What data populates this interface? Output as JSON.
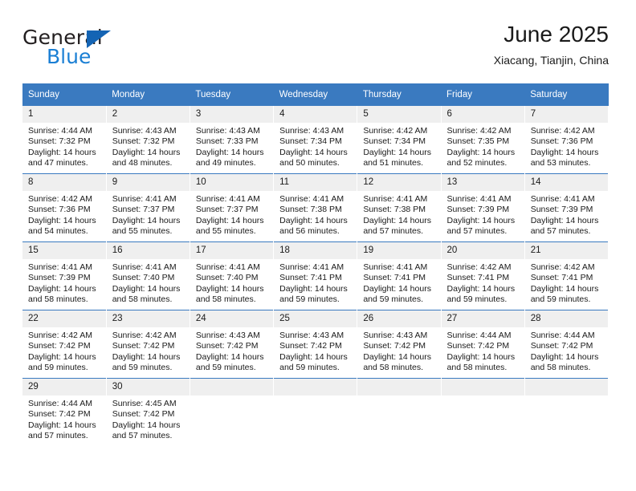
{
  "brand": {
    "name_part1": "General",
    "name_part2": "Blue",
    "logo_icon": "triangle-icon"
  },
  "header": {
    "title": "June 2025",
    "subtitle": "Xiacang, Tianjin, China"
  },
  "calendar": {
    "weekday_headers": [
      "Sunday",
      "Monday",
      "Tuesday",
      "Wednesday",
      "Thursday",
      "Friday",
      "Saturday"
    ],
    "accent_color": "#3a7ac0",
    "daynum_background": "#efefef",
    "weeks": [
      [
        {
          "day": "1",
          "sunrise": "Sunrise: 4:44 AM",
          "sunset": "Sunset: 7:32 PM",
          "daylight_line1": "Daylight: 14 hours",
          "daylight_line2": "and 47 minutes."
        },
        {
          "day": "2",
          "sunrise": "Sunrise: 4:43 AM",
          "sunset": "Sunset: 7:32 PM",
          "daylight_line1": "Daylight: 14 hours",
          "daylight_line2": "and 48 minutes."
        },
        {
          "day": "3",
          "sunrise": "Sunrise: 4:43 AM",
          "sunset": "Sunset: 7:33 PM",
          "daylight_line1": "Daylight: 14 hours",
          "daylight_line2": "and 49 minutes."
        },
        {
          "day": "4",
          "sunrise": "Sunrise: 4:43 AM",
          "sunset": "Sunset: 7:34 PM",
          "daylight_line1": "Daylight: 14 hours",
          "daylight_line2": "and 50 minutes."
        },
        {
          "day": "5",
          "sunrise": "Sunrise: 4:42 AM",
          "sunset": "Sunset: 7:34 PM",
          "daylight_line1": "Daylight: 14 hours",
          "daylight_line2": "and 51 minutes."
        },
        {
          "day": "6",
          "sunrise": "Sunrise: 4:42 AM",
          "sunset": "Sunset: 7:35 PM",
          "daylight_line1": "Daylight: 14 hours",
          "daylight_line2": "and 52 minutes."
        },
        {
          "day": "7",
          "sunrise": "Sunrise: 4:42 AM",
          "sunset": "Sunset: 7:36 PM",
          "daylight_line1": "Daylight: 14 hours",
          "daylight_line2": "and 53 minutes."
        }
      ],
      [
        {
          "day": "8",
          "sunrise": "Sunrise: 4:42 AM",
          "sunset": "Sunset: 7:36 PM",
          "daylight_line1": "Daylight: 14 hours",
          "daylight_line2": "and 54 minutes."
        },
        {
          "day": "9",
          "sunrise": "Sunrise: 4:41 AM",
          "sunset": "Sunset: 7:37 PM",
          "daylight_line1": "Daylight: 14 hours",
          "daylight_line2": "and 55 minutes."
        },
        {
          "day": "10",
          "sunrise": "Sunrise: 4:41 AM",
          "sunset": "Sunset: 7:37 PM",
          "daylight_line1": "Daylight: 14 hours",
          "daylight_line2": "and 55 minutes."
        },
        {
          "day": "11",
          "sunrise": "Sunrise: 4:41 AM",
          "sunset": "Sunset: 7:38 PM",
          "daylight_line1": "Daylight: 14 hours",
          "daylight_line2": "and 56 minutes."
        },
        {
          "day": "12",
          "sunrise": "Sunrise: 4:41 AM",
          "sunset": "Sunset: 7:38 PM",
          "daylight_line1": "Daylight: 14 hours",
          "daylight_line2": "and 57 minutes."
        },
        {
          "day": "13",
          "sunrise": "Sunrise: 4:41 AM",
          "sunset": "Sunset: 7:39 PM",
          "daylight_line1": "Daylight: 14 hours",
          "daylight_line2": "and 57 minutes."
        },
        {
          "day": "14",
          "sunrise": "Sunrise: 4:41 AM",
          "sunset": "Sunset: 7:39 PM",
          "daylight_line1": "Daylight: 14 hours",
          "daylight_line2": "and 57 minutes."
        }
      ],
      [
        {
          "day": "15",
          "sunrise": "Sunrise: 4:41 AM",
          "sunset": "Sunset: 7:39 PM",
          "daylight_line1": "Daylight: 14 hours",
          "daylight_line2": "and 58 minutes."
        },
        {
          "day": "16",
          "sunrise": "Sunrise: 4:41 AM",
          "sunset": "Sunset: 7:40 PM",
          "daylight_line1": "Daylight: 14 hours",
          "daylight_line2": "and 58 minutes."
        },
        {
          "day": "17",
          "sunrise": "Sunrise: 4:41 AM",
          "sunset": "Sunset: 7:40 PM",
          "daylight_line1": "Daylight: 14 hours",
          "daylight_line2": "and 58 minutes."
        },
        {
          "day": "18",
          "sunrise": "Sunrise: 4:41 AM",
          "sunset": "Sunset: 7:41 PM",
          "daylight_line1": "Daylight: 14 hours",
          "daylight_line2": "and 59 minutes."
        },
        {
          "day": "19",
          "sunrise": "Sunrise: 4:41 AM",
          "sunset": "Sunset: 7:41 PM",
          "daylight_line1": "Daylight: 14 hours",
          "daylight_line2": "and 59 minutes."
        },
        {
          "day": "20",
          "sunrise": "Sunrise: 4:42 AM",
          "sunset": "Sunset: 7:41 PM",
          "daylight_line1": "Daylight: 14 hours",
          "daylight_line2": "and 59 minutes."
        },
        {
          "day": "21",
          "sunrise": "Sunrise: 4:42 AM",
          "sunset": "Sunset: 7:41 PM",
          "daylight_line1": "Daylight: 14 hours",
          "daylight_line2": "and 59 minutes."
        }
      ],
      [
        {
          "day": "22",
          "sunrise": "Sunrise: 4:42 AM",
          "sunset": "Sunset: 7:42 PM",
          "daylight_line1": "Daylight: 14 hours",
          "daylight_line2": "and 59 minutes."
        },
        {
          "day": "23",
          "sunrise": "Sunrise: 4:42 AM",
          "sunset": "Sunset: 7:42 PM",
          "daylight_line1": "Daylight: 14 hours",
          "daylight_line2": "and 59 minutes."
        },
        {
          "day": "24",
          "sunrise": "Sunrise: 4:43 AM",
          "sunset": "Sunset: 7:42 PM",
          "daylight_line1": "Daylight: 14 hours",
          "daylight_line2": "and 59 minutes."
        },
        {
          "day": "25",
          "sunrise": "Sunrise: 4:43 AM",
          "sunset": "Sunset: 7:42 PM",
          "daylight_line1": "Daylight: 14 hours",
          "daylight_line2": "and 59 minutes."
        },
        {
          "day": "26",
          "sunrise": "Sunrise: 4:43 AM",
          "sunset": "Sunset: 7:42 PM",
          "daylight_line1": "Daylight: 14 hours",
          "daylight_line2": "and 58 minutes."
        },
        {
          "day": "27",
          "sunrise": "Sunrise: 4:44 AM",
          "sunset": "Sunset: 7:42 PM",
          "daylight_line1": "Daylight: 14 hours",
          "daylight_line2": "and 58 minutes."
        },
        {
          "day": "28",
          "sunrise": "Sunrise: 4:44 AM",
          "sunset": "Sunset: 7:42 PM",
          "daylight_line1": "Daylight: 14 hours",
          "daylight_line2": "and 58 minutes."
        }
      ],
      [
        {
          "day": "29",
          "sunrise": "Sunrise: 4:44 AM",
          "sunset": "Sunset: 7:42 PM",
          "daylight_line1": "Daylight: 14 hours",
          "daylight_line2": "and 57 minutes."
        },
        {
          "day": "30",
          "sunrise": "Sunrise: 4:45 AM",
          "sunset": "Sunset: 7:42 PM",
          "daylight_line1": "Daylight: 14 hours",
          "daylight_line2": "and 57 minutes."
        },
        {
          "day": "",
          "sunrise": "",
          "sunset": "",
          "daylight_line1": "",
          "daylight_line2": ""
        },
        {
          "day": "",
          "sunrise": "",
          "sunset": "",
          "daylight_line1": "",
          "daylight_line2": ""
        },
        {
          "day": "",
          "sunrise": "",
          "sunset": "",
          "daylight_line1": "",
          "daylight_line2": ""
        },
        {
          "day": "",
          "sunrise": "",
          "sunset": "",
          "daylight_line1": "",
          "daylight_line2": ""
        },
        {
          "day": "",
          "sunrise": "",
          "sunset": "",
          "daylight_line1": "",
          "daylight_line2": ""
        }
      ]
    ]
  }
}
